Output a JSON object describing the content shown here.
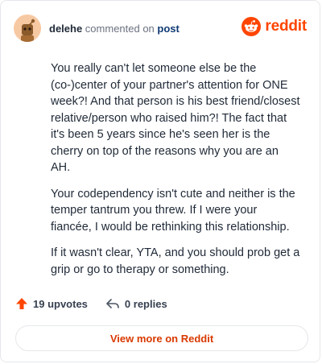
{
  "comment": {
    "username": "delehe",
    "action_text": " commented on ",
    "post_link_text": "post",
    "paragraphs": [
      "You really can't let someone else be the (co-)center of your partner's attention for ONE week?! And that person is his best friend/closest relative/person who raised him?! The fact that it's been 5 years since he's seen her is the cherry on top of the reasons why you are an AH.",
      "Your codependency isn't cute and neither is the temper tantrum you threw. If I were your fiancée, I would be rethinking this relationship.",
      "If it wasn't clear, YTA, and you should prob get a grip or go to therapy or something."
    ]
  },
  "brand": {
    "wordmark": "reddit",
    "logo_icon": "reddit-snoo-icon",
    "color": "#ff4500"
  },
  "actions": {
    "upvotes_label": "19 upvotes",
    "upvote_icon": "upvote-arrow-icon",
    "replies_label": "0 replies",
    "reply_icon": "reply-arrow-icon"
  },
  "footer": {
    "view_more_label": "View more on Reddit"
  },
  "colors": {
    "accent": "#ff4500",
    "link": "#0f3a74",
    "view_more": "#d93900"
  }
}
